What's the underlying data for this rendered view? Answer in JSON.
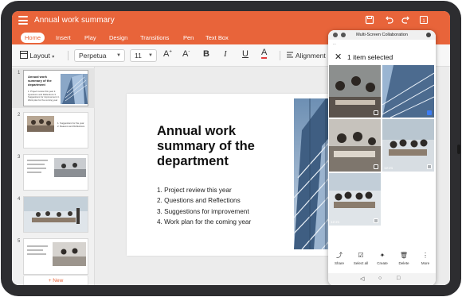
{
  "app": {
    "doc_title": "Annual work summary",
    "tabs": [
      "Home",
      "Insert",
      "Play",
      "Design",
      "Transitions",
      "Pen",
      "Text Box"
    ],
    "active_tab": "Home",
    "toolbar": {
      "layout_label": "Layout",
      "font_name": "Perpetua",
      "font_size": "11",
      "alignment_label": "Alignment"
    },
    "slide_numbers": [
      "1",
      "2",
      "3",
      "4",
      "5"
    ],
    "thumb1_title": "Annual work summary of the department",
    "thumb1_items": "1. Project review this year 2. Questions and Reflections 3. Suggestions for improvement 4. Work plan for the coming year",
    "thumb2_items": "1. Suggestions for the year 2. Reasons and Reflections",
    "new_button": "+ New"
  },
  "slide": {
    "title": "Annual work summary of the department",
    "items": [
      "1. Project review this year",
      "2. Questions and Reflections",
      "3. Suggestions for improvement",
      "4. Work plan for the coming year"
    ]
  },
  "collab": {
    "header": "Multi-Screen Collaboration",
    "status_left": "...",
    "selection_title": "1 item selected",
    "durations": [
      "12:21",
      "12:21"
    ],
    "actions": [
      "Share",
      "Select all",
      "Create",
      "Delete",
      "More"
    ]
  },
  "colors": {
    "accent": "#e8643a",
    "select_blue": "#3d7df5"
  }
}
